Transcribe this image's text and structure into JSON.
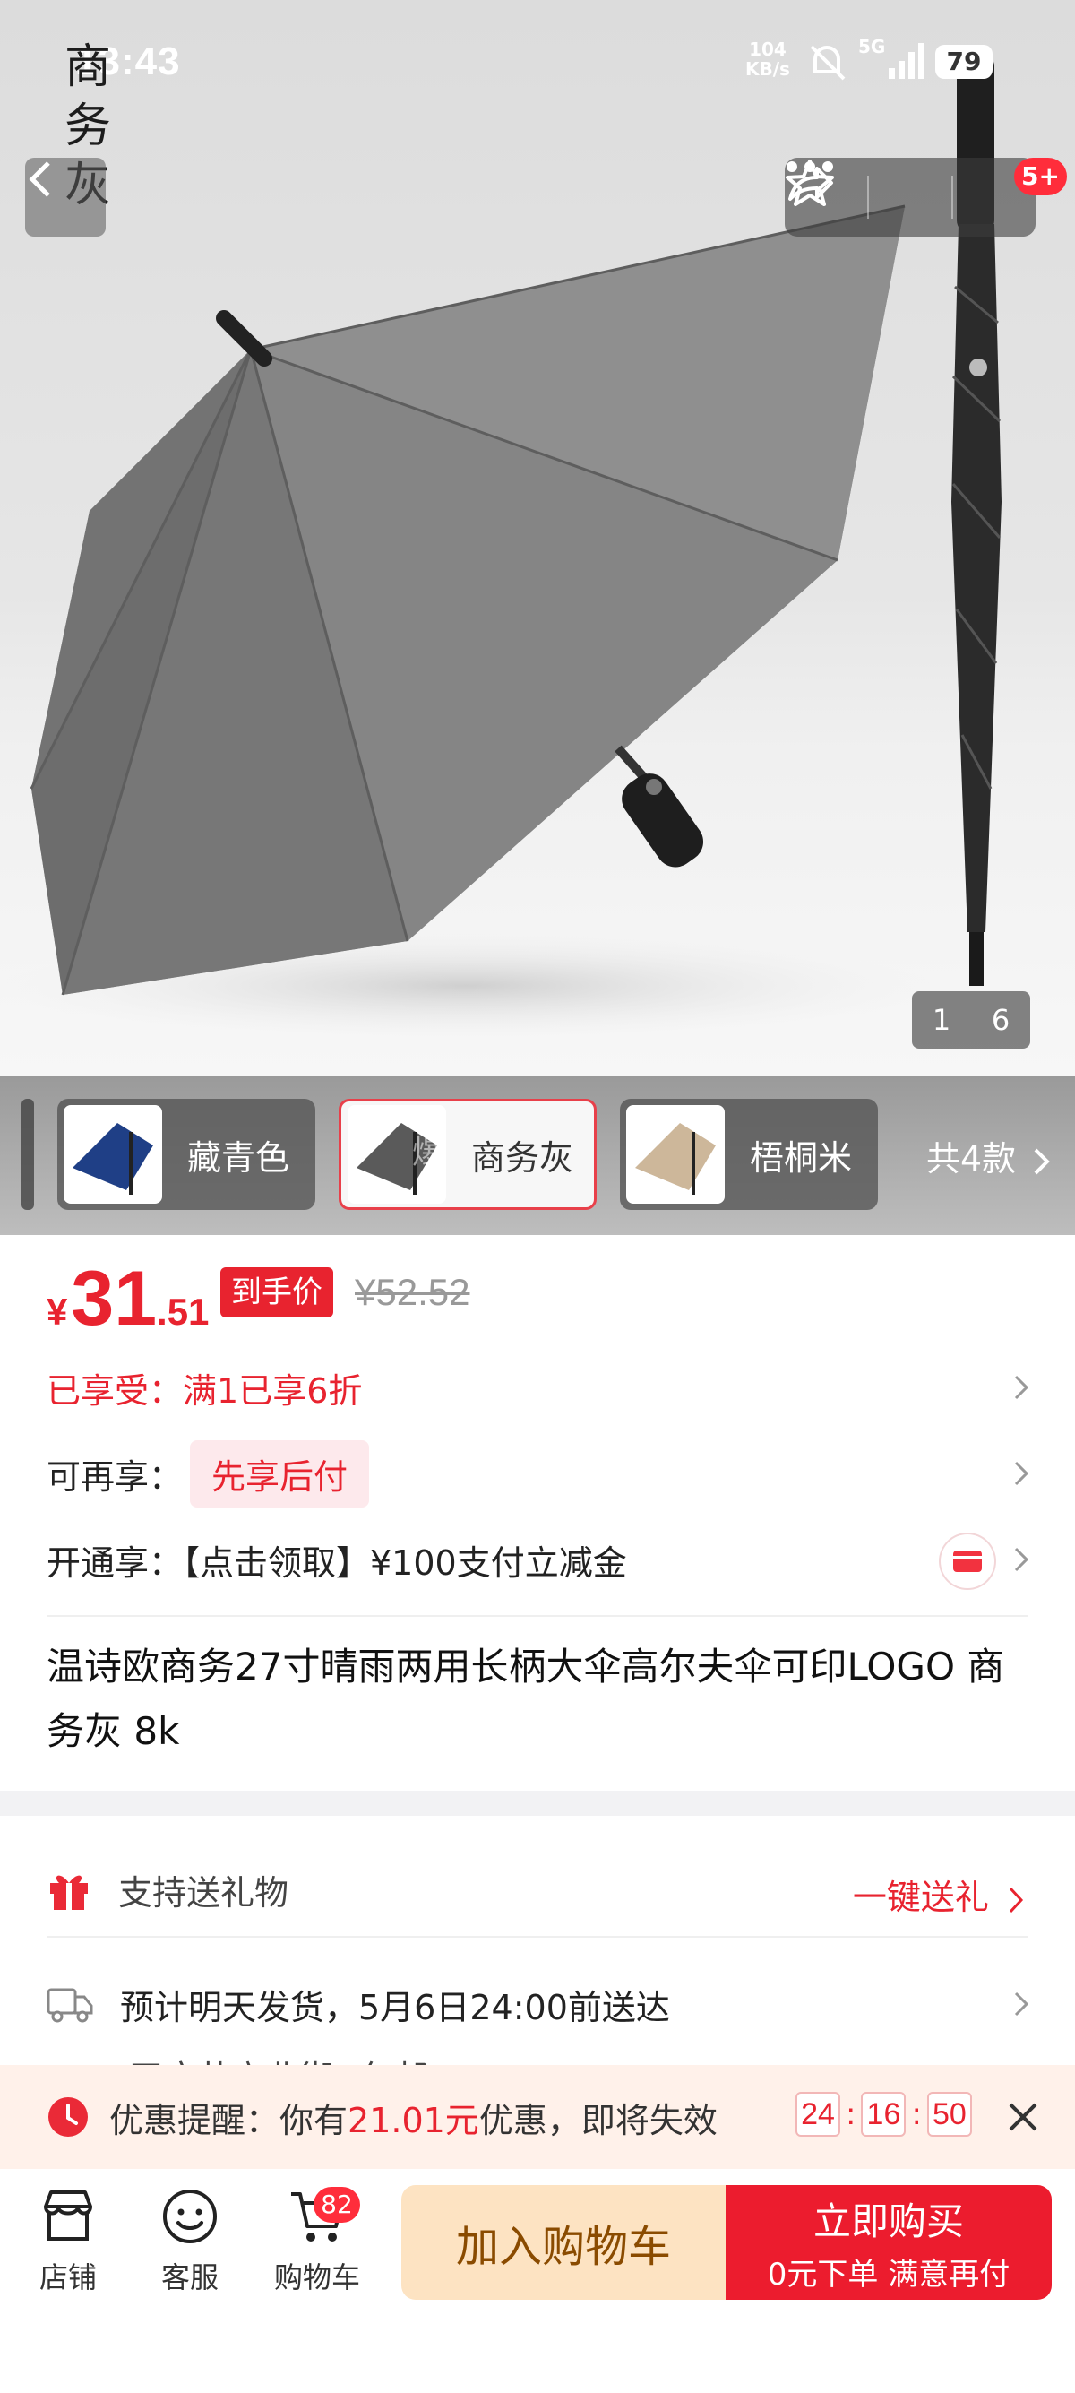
{
  "status_bar": {
    "time": "13:43",
    "net_speed_value": "104",
    "net_speed_unit": "KB/s",
    "signal_label": "5G",
    "battery": "79"
  },
  "hero": {
    "variant_vertical_label": [
      "商",
      "务",
      "灰"
    ],
    "more_badge": "5+",
    "page_current": "1",
    "page_total": "6"
  },
  "variants": {
    "items": [
      {
        "name": "藏青色",
        "color": "#1f3f86"
      },
      {
        "name": "商务灰",
        "color": "#5a5a5a"
      },
      {
        "name": "梧桐米",
        "color": "#cdb79a"
      }
    ],
    "selected_index": 1,
    "watermark": "爆",
    "count_label": "共4款"
  },
  "price": {
    "symbol": "¥",
    "integer": "31",
    "decimal": ".51",
    "tag": "到手价",
    "original": "¥52.52"
  },
  "promos": {
    "enjoyed_prefix": "已享受：",
    "enjoyed_text": "满1已享6折",
    "more_prefix": "可再享：",
    "more_pill": "先享后付",
    "open_text": "开通享：【点击领取】¥100支付立减金"
  },
  "product": {
    "title": "温诗欧商务27寸晴雨两用长柄大伞高尔夫伞可印LOGO 商务灰 8k"
  },
  "service": {
    "gift_label": "支持送礼物",
    "gift_link": "一键送礼",
    "ship_text": "预计明天发货，5月6日24:00前送达",
    "ship_origin": "王府井商业街",
    "ship_fee": "包邮"
  },
  "reminder": {
    "prefix": "优惠提醒：你有",
    "amount": "21.01元",
    "suffix": "优惠，即将失效",
    "hours": "24",
    "minutes": "16",
    "seconds": "50"
  },
  "bottom_bar": {
    "shop_label": "店铺",
    "service_label": "客服",
    "cart_label": "购物车",
    "cart_count": "82",
    "add_to_cart": "加入购物车",
    "buy_now": "立即购买",
    "buy_sub": "0元下单 满意再付"
  },
  "colors": {
    "accent": "#e8232f",
    "buy_button": "#ec1c2e",
    "cart_button": "#fde3c2"
  }
}
